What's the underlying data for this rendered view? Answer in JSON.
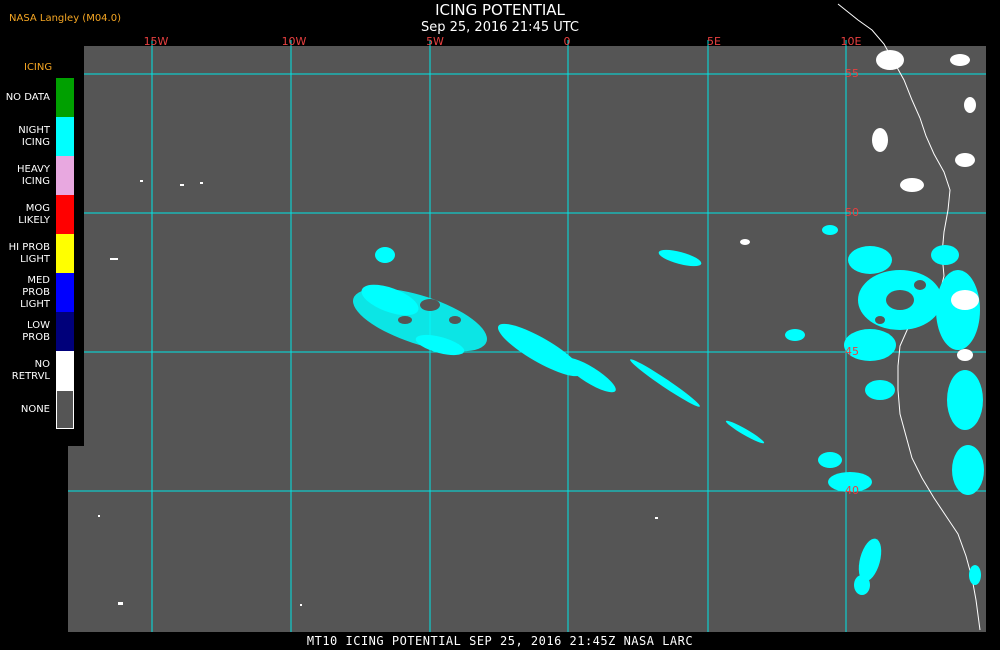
{
  "header": {
    "brand": "NASA Langley (M04.0)",
    "title": "ICING POTENTIAL",
    "datetime": "Sep 25, 2016 21:45 UTC"
  },
  "legend": {
    "title": "ICING",
    "items": [
      {
        "label": "NO DATA",
        "color": "#00a000"
      },
      {
        "label": "NIGHT\nICING",
        "color": "#00ffff"
      },
      {
        "label": "HEAVY\nICING",
        "color": "#e8a8e0"
      },
      {
        "label": "MOG\nLIKELY",
        "color": "#ff0000"
      },
      {
        "label": "HI PROB\nLIGHT",
        "color": "#ffff00"
      },
      {
        "label": "MED PROB\nLIGHT",
        "color": "#0000ff"
      },
      {
        "label": "LOW\nPROB",
        "color": "#00007a"
      },
      {
        "label": "NO\nRETRVL",
        "color": "#ffffff"
      },
      {
        "label": "NONE",
        "color": "#555555"
      }
    ]
  },
  "map": {
    "background": "#555555",
    "grid_color": "#00e5e5",
    "label_color": "#e84040",
    "lon_labels": [
      "15W",
      "10W",
      "5W",
      "0",
      "5E",
      "10E"
    ],
    "lat_labels": [
      "55",
      "50",
      "45",
      "40"
    ]
  },
  "footer": {
    "caption": "MT10  ICING POTENTIAL   SEP 25, 2016 21:45Z   NASA LARC"
  }
}
